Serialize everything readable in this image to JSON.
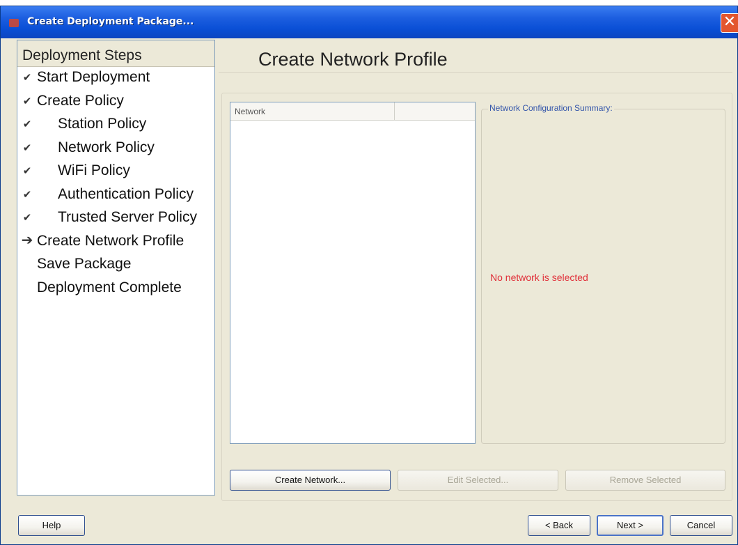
{
  "window": {
    "title": "Create Deployment Package...",
    "close_glyph": "✕"
  },
  "steps": {
    "header": "Deployment Steps",
    "items": [
      {
        "label": "Start Deployment",
        "status": "done"
      },
      {
        "label": "Create Policy",
        "status": "done"
      },
      {
        "label": "Station Policy",
        "status": "done"
      },
      {
        "label": "Network Policy",
        "status": "done"
      },
      {
        "label": "WiFi Policy",
        "status": "done"
      },
      {
        "label": "Authentication Policy",
        "status": "done"
      },
      {
        "label": "Trusted Server Policy",
        "status": "done"
      },
      {
        "label": "Create Network Profile",
        "status": "current"
      },
      {
        "label": "Save Package",
        "status": "pending"
      },
      {
        "label": "Deployment Complete",
        "status": "pending"
      }
    ],
    "check_glyph": "✔",
    "arrow_glyph": "➔"
  },
  "main": {
    "page_title": "Create Network Profile",
    "network_list": {
      "columns": [
        "Network",
        ""
      ],
      "rows": []
    },
    "summary": {
      "legend": "Network Configuration Summary:",
      "message": "No network is selected",
      "message_color": "#e0303a"
    },
    "actions": {
      "create_label": "Create Network...",
      "edit_label": "Edit Selected...",
      "remove_label": "Remove Selected"
    }
  },
  "footer": {
    "help_label": "Help",
    "back_label": "< Back",
    "next_label": "Next >",
    "cancel_label": "Cancel"
  },
  "colors": {
    "titlebar": "#0a4fd6",
    "dialog_background": "#ece9d8",
    "close_button": "#e3562f"
  }
}
